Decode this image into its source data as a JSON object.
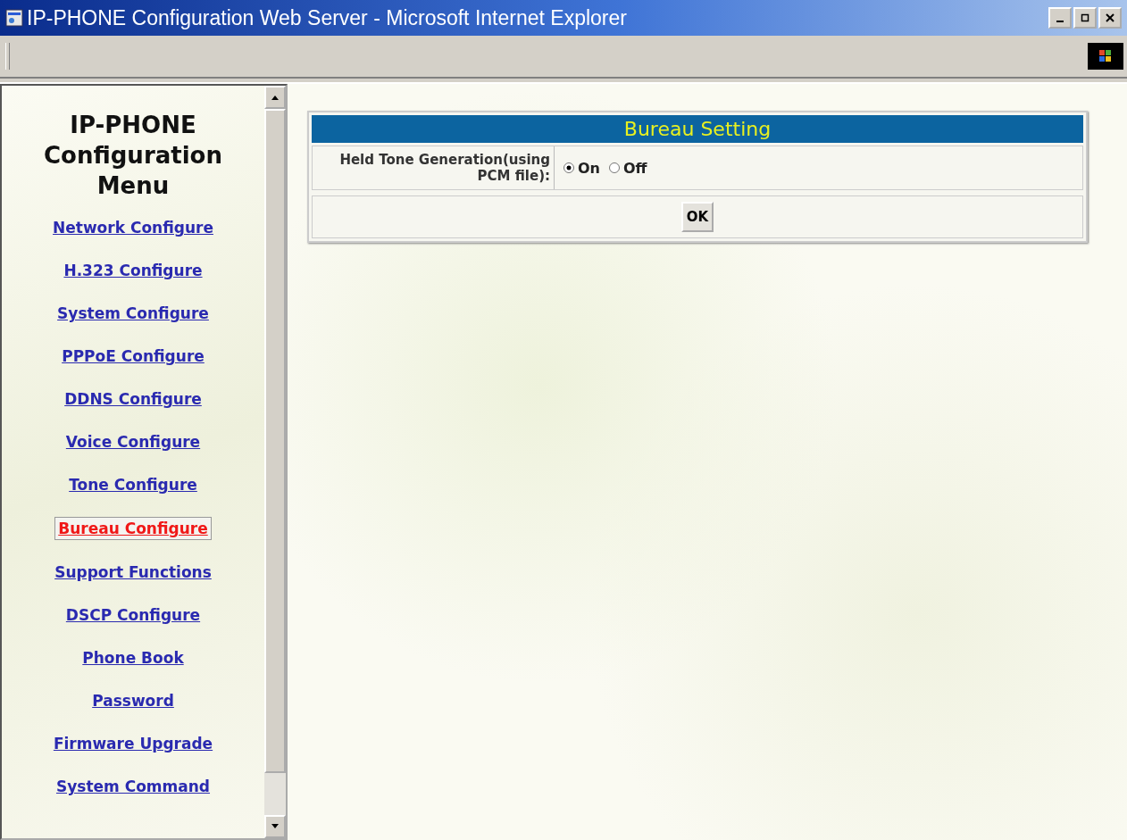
{
  "window": {
    "title": "IP-PHONE Configuration Web Server - Microsoft Internet Explorer"
  },
  "sidebar": {
    "heading": "IP-PHONE Configuration Menu",
    "items": [
      {
        "label": "Network Configure",
        "selected": false
      },
      {
        "label": "H.323 Configure",
        "selected": false
      },
      {
        "label": "System Configure",
        "selected": false
      },
      {
        "label": "PPPoE Configure",
        "selected": false
      },
      {
        "label": "DDNS Configure",
        "selected": false
      },
      {
        "label": "Voice Configure",
        "selected": false
      },
      {
        "label": "Tone Configure",
        "selected": false
      },
      {
        "label": "Bureau Configure",
        "selected": true
      },
      {
        "label": "Support Functions",
        "selected": false
      },
      {
        "label": "DSCP Configure",
        "selected": false
      },
      {
        "label": "Phone Book",
        "selected": false
      },
      {
        "label": "Password",
        "selected": false
      },
      {
        "label": "Firmware Upgrade",
        "selected": false
      },
      {
        "label": "System Command",
        "selected": false
      }
    ]
  },
  "panel": {
    "title": "Bureau Setting",
    "field_label": "Held Tone Generation(using PCM file):",
    "options": [
      {
        "label": "On",
        "selected": true
      },
      {
        "label": "Off",
        "selected": false
      }
    ],
    "button": "OK"
  }
}
